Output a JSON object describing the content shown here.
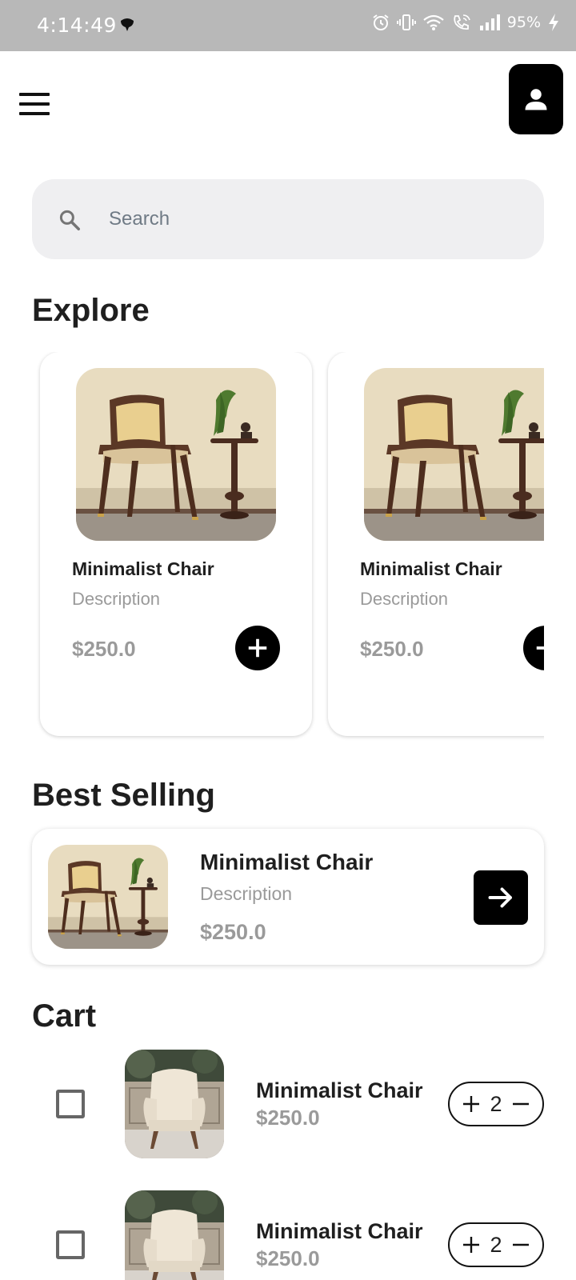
{
  "status_bar": {
    "time": "4:14:49",
    "battery": "95%",
    "icons": [
      "alarm-icon",
      "vibrate-icon",
      "wifi-icon",
      "wifi-calling-icon",
      "signal-icon",
      "battery-charging-icon"
    ]
  },
  "header": {
    "menu_icon": "hamburger-menu-icon",
    "profile_icon": "person-icon"
  },
  "search": {
    "placeholder": "Search",
    "value": ""
  },
  "explore": {
    "title": "Explore",
    "cards": [
      {
        "name": "Minimalist Chair",
        "description": "Description",
        "price": "$250.0"
      },
      {
        "name": "Minimalist Chair",
        "description": "Description",
        "price": "$250.0"
      }
    ]
  },
  "best_selling": {
    "title": "Best Selling",
    "item": {
      "name": "Minimalist Chair",
      "description": "Description",
      "price": "$250.0"
    }
  },
  "cart": {
    "title": "Cart",
    "items": [
      {
        "name": "Minimalist Chair",
        "price": "$250.0",
        "quantity": "2",
        "checked": false
      },
      {
        "name": "Minimalist Chair",
        "price": "$250.0",
        "quantity": "2",
        "checked": false
      }
    ]
  },
  "colors": {
    "accent": "#000000",
    "search_bg": "#efeff1",
    "muted_text": "#9a9a9a"
  }
}
